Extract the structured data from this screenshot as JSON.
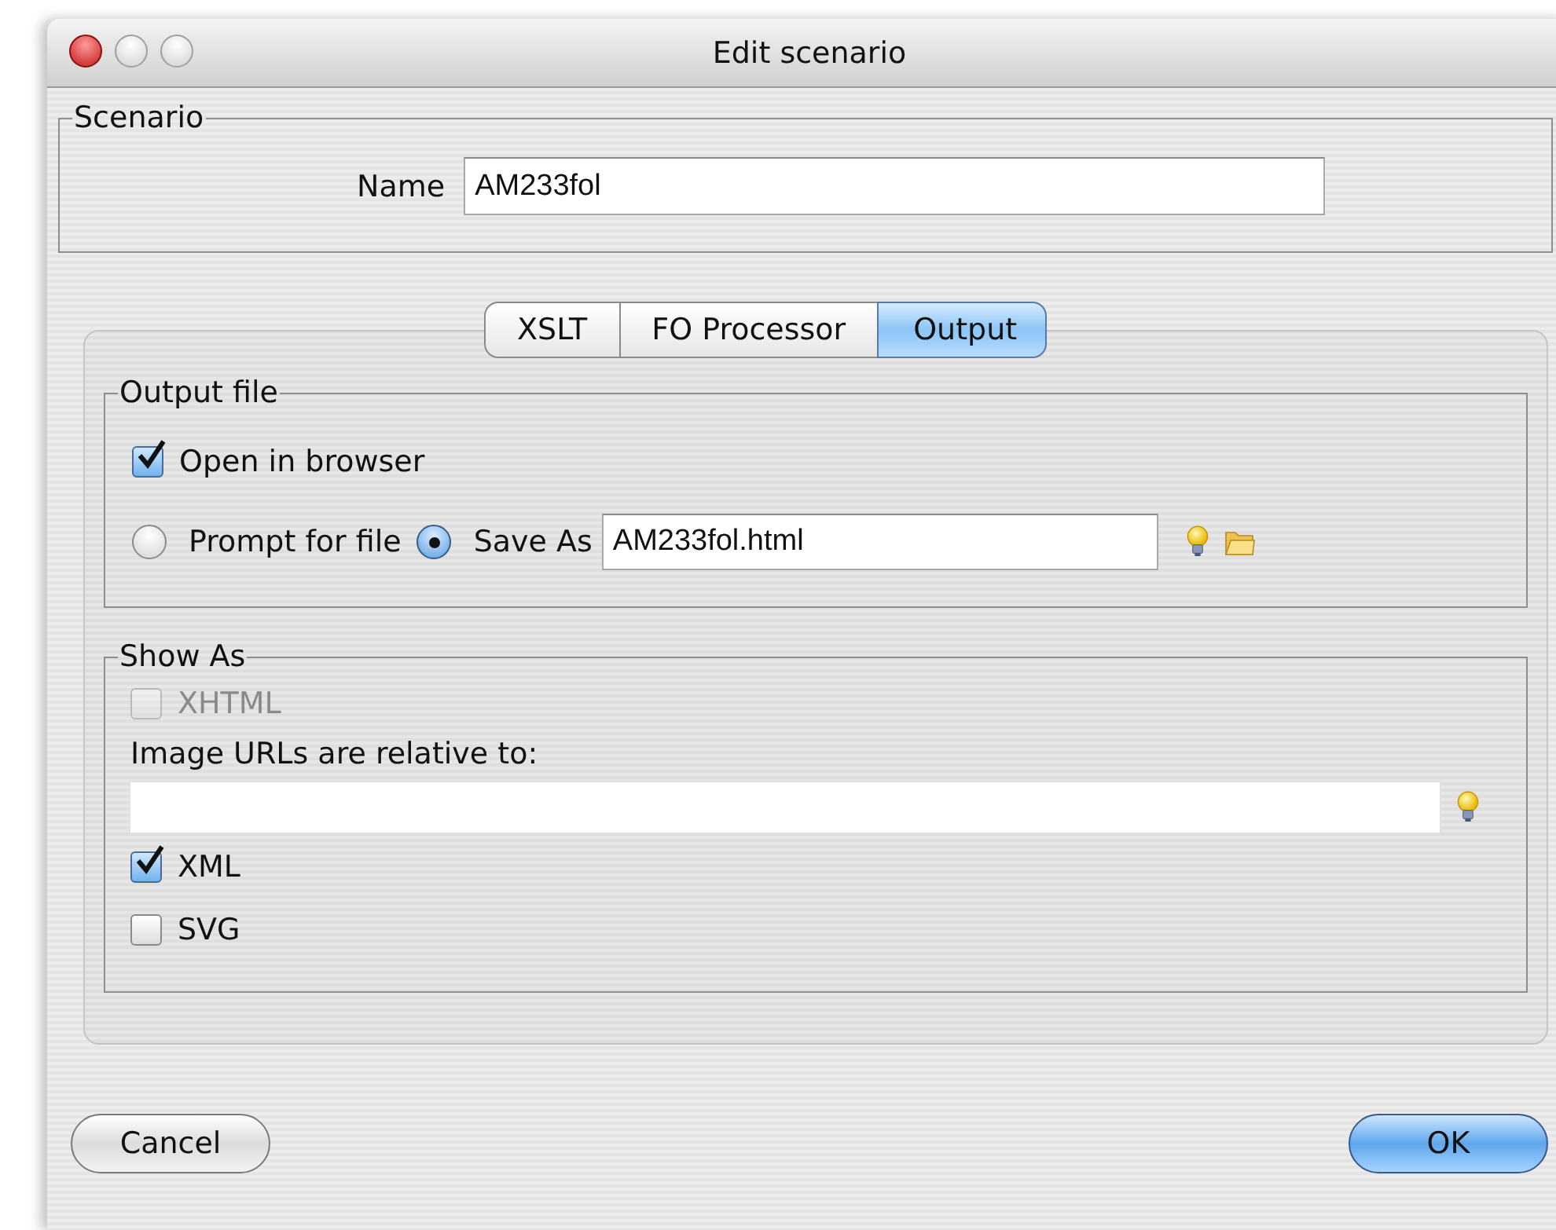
{
  "window": {
    "title": "Edit scenario"
  },
  "scenario": {
    "legend": "Scenario",
    "name_label": "Name",
    "name_value": "AM233fol"
  },
  "tabs": [
    {
      "label": "XSLT",
      "selected": false
    },
    {
      "label": "FO Processor",
      "selected": false
    },
    {
      "label": "Output",
      "selected": true
    }
  ],
  "output_file": {
    "legend": "Output file",
    "open_in_browser": {
      "label": "Open in browser",
      "checked": true
    },
    "destination": [
      {
        "label": "Prompt for file",
        "selected": false
      },
      {
        "label": "Save As",
        "selected": true
      }
    ],
    "save_as_value": "AM233fol.html"
  },
  "show_as": {
    "legend": "Show As",
    "items": [
      {
        "kind": "checkbox",
        "label": "XHTML",
        "checked": false,
        "disabled": true
      },
      {
        "kind": "field",
        "label": "Image URLs are relative to:"
      },
      {
        "kind": "checkbox",
        "label": "XML",
        "checked": true,
        "disabled": false
      },
      {
        "kind": "checkbox",
        "label": "SVG",
        "checked": false,
        "disabled": false
      }
    ]
  },
  "buttons": [
    {
      "label": "Cancel",
      "default": false
    },
    {
      "label": "OK",
      "default": true
    }
  ]
}
